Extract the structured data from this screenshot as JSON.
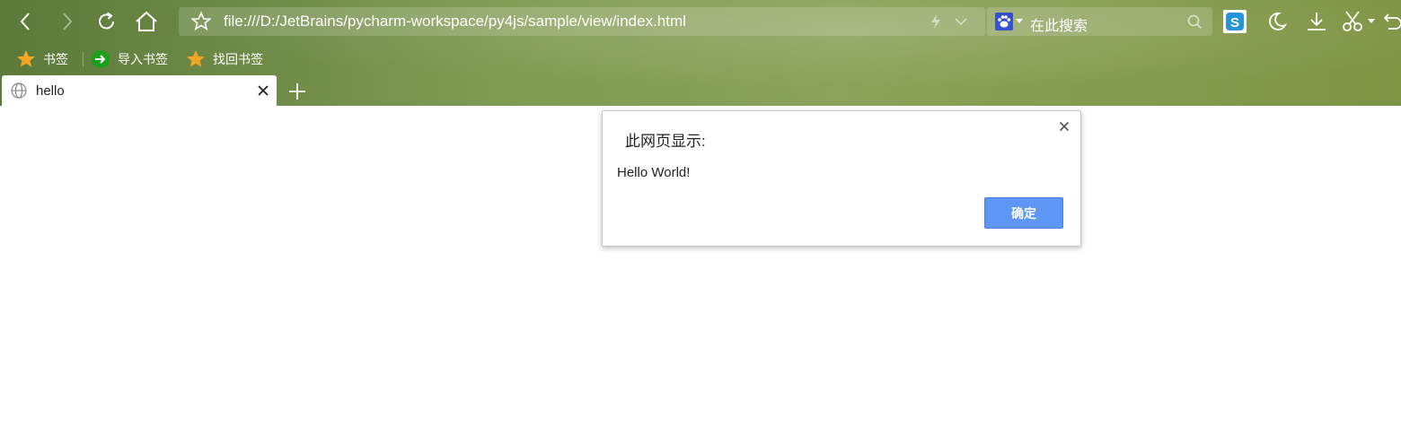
{
  "browser": {
    "address": "file:///D:/JetBrains/pycharm-workspace/py4js/sample/view/index.html",
    "search_placeholder": "在此搜索"
  },
  "bookmarks": [
    {
      "label": "书签",
      "icon": "star-icon"
    },
    {
      "label": "导入书签",
      "icon": "import-arrow-icon"
    },
    {
      "label": "找回书签",
      "icon": "star-icon"
    }
  ],
  "tabs": [
    {
      "title": "hello",
      "icon": "globe-icon"
    }
  ],
  "dialog": {
    "title": "此网页显示:",
    "message": "Hello World!",
    "ok_label": "确定"
  },
  "colors": {
    "chrome_green": "#7f9a52",
    "ok_button": "#5d96f5",
    "bookmark_star": "#f5a623",
    "import_icon": "#1aa01a",
    "skype": "#1b8fd6",
    "paw_icon": "#2541c5"
  }
}
